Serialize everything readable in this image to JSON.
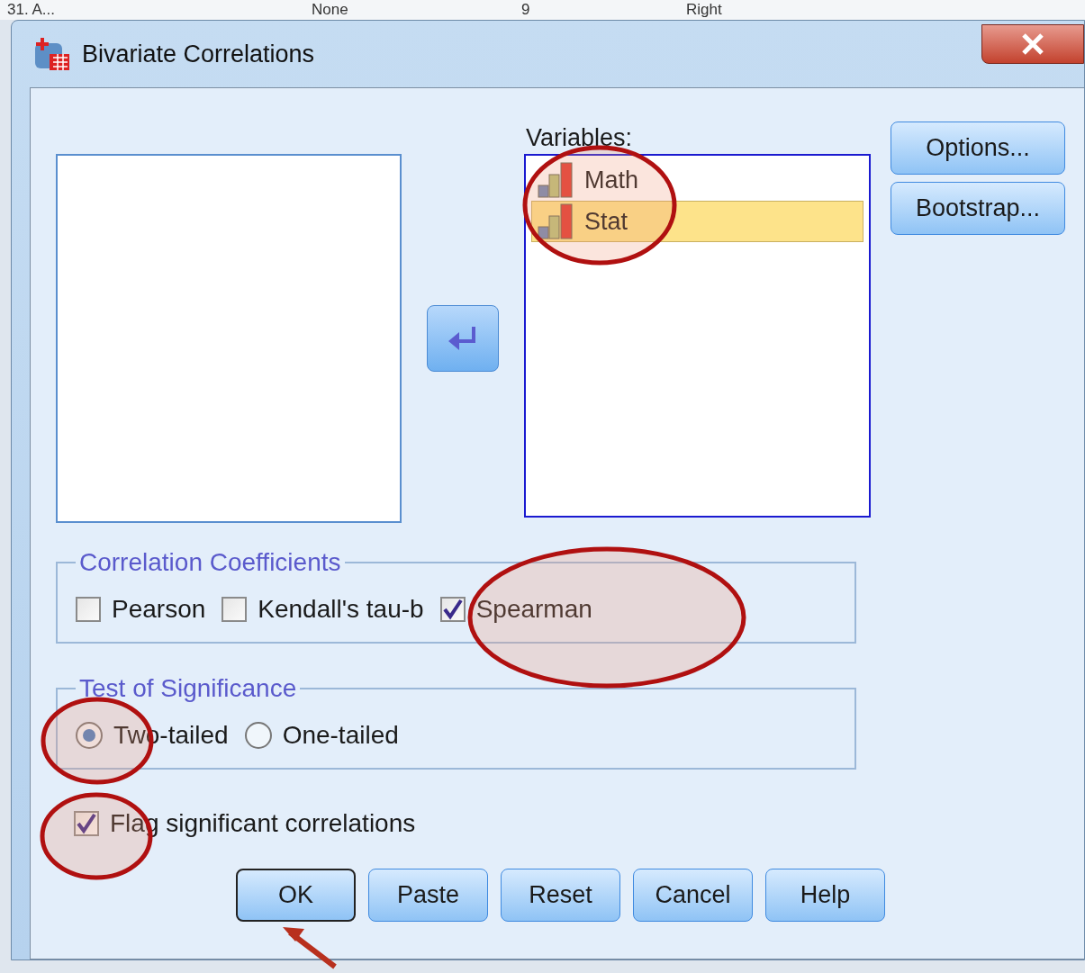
{
  "background_row": [
    {
      "text": "31. A..."
    },
    {
      "text": "None"
    },
    {
      "text": "9"
    },
    {
      "text": "Right"
    }
  ],
  "window": {
    "title": "Bivariate Correlations"
  },
  "variables": {
    "label": "Variables:",
    "items": [
      {
        "name": "Math",
        "selected": false
      },
      {
        "name": "Stat",
        "selected": true
      }
    ]
  },
  "side_buttons": [
    "Options...",
    "Bootstrap..."
  ],
  "coefficients": {
    "title": "Correlation Coefficients",
    "options": [
      {
        "label": "Pearson",
        "checked": false
      },
      {
        "label": "Kendall's tau-b",
        "checked": false
      },
      {
        "label": "Spearman",
        "checked": true
      }
    ]
  },
  "significance": {
    "title": "Test of Significance",
    "options": [
      {
        "label": "Two-tailed",
        "selected": true
      },
      {
        "label": "One-tailed",
        "selected": false
      }
    ]
  },
  "flag": {
    "label": "Flag significant correlations",
    "checked": true
  },
  "buttons": [
    {
      "label": "OK",
      "default": true
    },
    {
      "label": "Paste",
      "default": false
    },
    {
      "label": "Reset",
      "default": false
    },
    {
      "label": "Cancel",
      "default": false
    },
    {
      "label": "Help",
      "default": false
    }
  ]
}
